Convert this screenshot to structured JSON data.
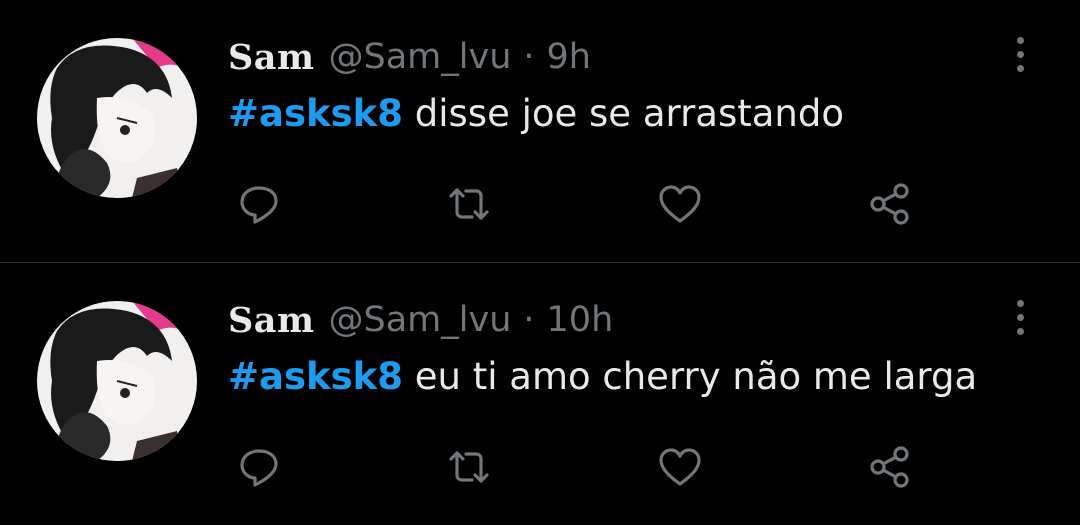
{
  "tweets": [
    {
      "display_name": "Sam",
      "handle": "@Sam_lvu",
      "separator": "·",
      "time": "9h",
      "hashtag": "#asksk8",
      "text": " disse joe se arrastando"
    },
    {
      "display_name": "Sam",
      "handle": "@Sam_lvu",
      "separator": "·",
      "time": "10h",
      "hashtag": "#asksk8",
      "text": " eu ti amo cherry não me larga"
    }
  ],
  "actions": [
    "reply-icon",
    "retweet-icon",
    "like-icon",
    "share-icon"
  ],
  "colors": {
    "background": "#000000",
    "text_primary": "#e7e9ea",
    "text_secondary": "#71767b",
    "accent": "#1d9bf0",
    "divider": "#2f3336"
  }
}
